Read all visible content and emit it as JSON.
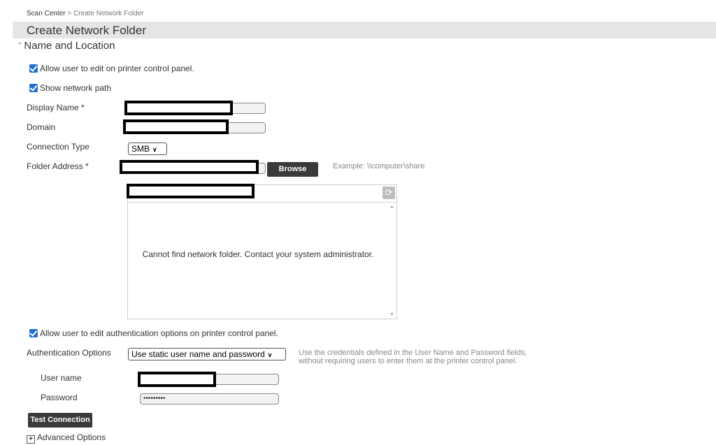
{
  "breadcrumb": {
    "root": "Scan Center",
    "separator": " > ",
    "current": "Create Network Folder"
  },
  "page_title": "Create Network Folder",
  "section": {
    "title": "Name and Location",
    "collapse_icon": "double-chevron-up-icon"
  },
  "checkboxes": {
    "allow_edit_panel": {
      "label": "Allow user to edit on printer control panel.",
      "checked": true
    },
    "show_network_path": {
      "label": "Show network path",
      "checked": true
    },
    "allow_edit_auth": {
      "label": "Allow user to edit authentication options on printer control panel.",
      "checked": true
    }
  },
  "fields": {
    "display_name": {
      "label": "Display Name *",
      "value": ""
    },
    "domain": {
      "label": "Domain",
      "value": ""
    },
    "connection_type": {
      "label": "Connection Type",
      "selected": "SMB"
    },
    "folder_address": {
      "label": "Folder Address *",
      "value": "",
      "browse_label": "Browse",
      "example": "Example: \\\\computer\\share"
    },
    "auth_options": {
      "label": "Authentication Options",
      "selected": "Use static user name and password",
      "hint": "Use the credentials defined in the User Name and Password fields, without requiring users to enter them at the printer control panel."
    },
    "user_name": {
      "label": "User name",
      "value": ""
    },
    "password": {
      "label": "Password",
      "value": "•••••••••"
    }
  },
  "folder_browser": {
    "message": "Cannot find network folder. Contact your system administrator.",
    "refresh_icon": "refresh-icon"
  },
  "buttons": {
    "test_connection": "Test Connection"
  },
  "advanced": {
    "label": "Advanced Options",
    "icon": "plus-box-icon"
  },
  "colors": {
    "checkbox": "#1f6fd0",
    "title_bar": "#e5e5e5",
    "button_dark": "#3a3a3a"
  }
}
